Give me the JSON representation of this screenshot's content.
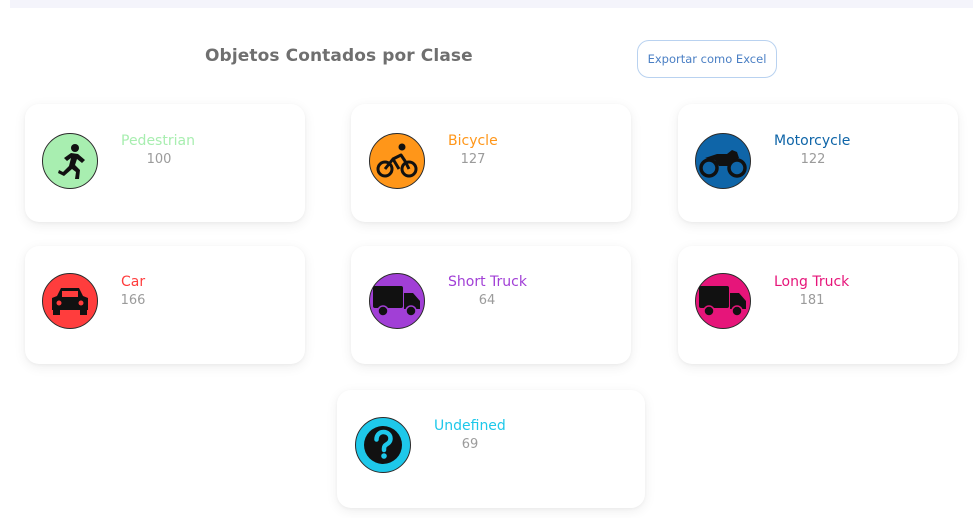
{
  "header": {
    "title": "Objetos Contados por Clase",
    "export_label": "Exportar como Excel"
  },
  "classes": [
    {
      "label": "Pedestrian",
      "count": "100",
      "color": "#a8eeb0",
      "icon": "running-person-icon"
    },
    {
      "label": "Bicycle",
      "count": "127",
      "color": "#ff9619",
      "icon": "bicycle-icon"
    },
    {
      "label": "Motorcycle",
      "count": "122",
      "color": "#0f65a8",
      "icon": "motorcycle-icon"
    },
    {
      "label": "Car",
      "count": "166",
      "color": "#ff3d3d",
      "icon": "car-icon"
    },
    {
      "label": "Short Truck",
      "count": "64",
      "color": "#a13fd6",
      "icon": "truck-icon"
    },
    {
      "label": "Long Truck",
      "count": "181",
      "color": "#e6157a",
      "icon": "truck-icon"
    },
    {
      "label": "Undefined",
      "count": "69",
      "color": "#1ec8ea",
      "icon": "question-mark-icon"
    }
  ]
}
